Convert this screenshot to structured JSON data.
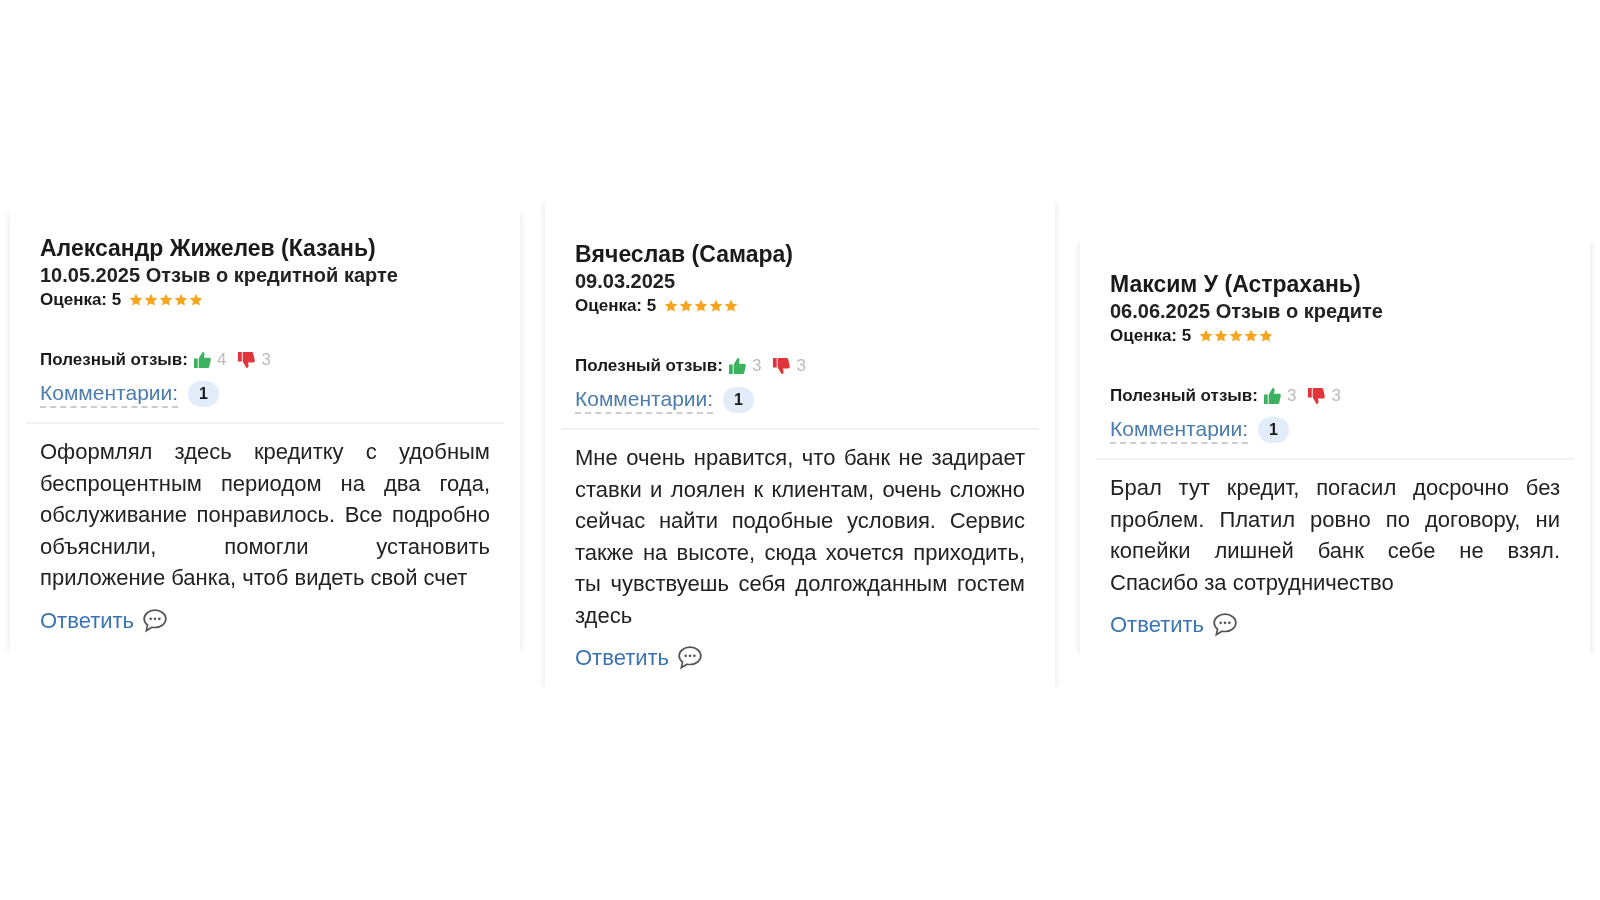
{
  "reviews": [
    {
      "author": "Александр Жижелев (Казань)",
      "subtitle": "10.05.2025 Отзыв о кредитной карте",
      "rating_label": "Оценка: 5",
      "stars": 5,
      "helpful_label": "Полезный отзыв:",
      "likes": "4",
      "dislikes": "3",
      "comments_label": "Комментарии:",
      "comments_count": "1",
      "text": "Оформлял здесь кредитку с удобным беспроцентным периодом на два года, обслуживание понравилось. Все подробно объяснили, помогли установить приложение банка, чтоб видеть свой счет",
      "reply": "Ответить"
    },
    {
      "author": "Вячеслав (Самара)",
      "subtitle": "09.03.2025",
      "rating_label": "Оценка: 5",
      "stars": 5,
      "helpful_label": "Полезный отзыв:",
      "likes": "3",
      "dislikes": "3",
      "comments_label": "Комментарии:",
      "comments_count": "1",
      "text": "Мне очень нравится, что банк не задирает ставки и лоялен к клиентам, очень сложно сейчас найти подобные условия. Сервис также на высоте, сюда хочется приходить, ты чувствуешь себя долгожданным гостем здесь",
      "reply": "Ответить"
    },
    {
      "author": "Максим У (Астрахань)",
      "subtitle": "06.06.2025 Отзыв о кредите",
      "rating_label": "Оценка: 5",
      "stars": 5,
      "helpful_label": "Полезный отзыв:",
      "likes": "3",
      "dislikes": "3",
      "comments_label": "Комментарии:",
      "comments_count": "1",
      "text": "Брал тут кредит, погасил досрочно без проблем. Платил ровно по договору, ни копейки лишней банк себе не взял. Спасибо за сотрудничество",
      "reply": "Ответить"
    }
  ]
}
